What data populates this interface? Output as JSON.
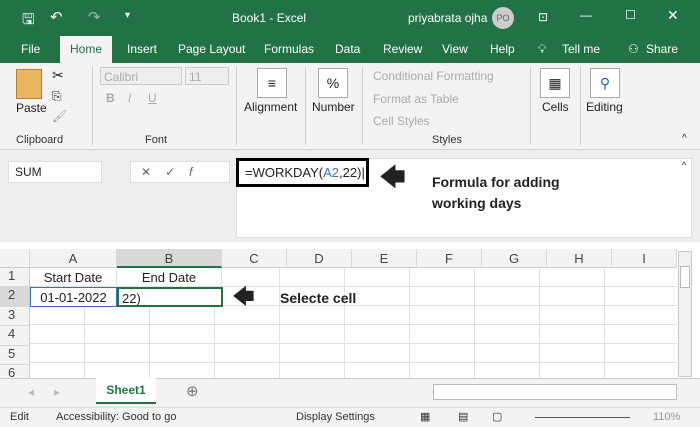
{
  "title": {
    "doc": "Book1  -  Excel",
    "user": "priyabrata ojha",
    "avatar": "PO"
  },
  "tabs": [
    "File",
    "Home",
    "Insert",
    "Page Layout",
    "Formulas",
    "Data",
    "Review",
    "View",
    "Help",
    "Tell me",
    "Share"
  ],
  "ribbon": {
    "paste": "Paste",
    "clipboard": "Clipboard",
    "font_name": "Calibri",
    "font_size": "11",
    "font": "Font",
    "alignment": "Alignment",
    "number": "Number",
    "cond_format": "Conditional Formatting",
    "format_table": "Format as Table",
    "cell_styles": "Cell Styles",
    "styles": "Styles",
    "cells": "Cells",
    "editing": "Editing",
    "bold": "B",
    "italic": "I",
    "underline": "U"
  },
  "formula_bar": {
    "name_box": "SUM",
    "formula_prefix": "=WORKDAY(",
    "formula_ref": "A2",
    "formula_suffix": ",22)",
    "annotation": "Formula for adding working days"
  },
  "columns": [
    "A",
    "B",
    "C",
    "D",
    "E",
    "F",
    "G",
    "H",
    "I"
  ],
  "rows": [
    "1",
    "2",
    "3",
    "4",
    "5",
    "6"
  ],
  "cells": {
    "A1": "Start Date",
    "B1": "End Date",
    "A2": "01-01-2022",
    "B2": "22)"
  },
  "cell_annotation": "Selecte cell",
  "sheet_tab": "Sheet1",
  "status": {
    "mode": "Edit",
    "accessibility": "Accessibility: Good to go",
    "display": "Display Settings",
    "zoom": "110%"
  }
}
